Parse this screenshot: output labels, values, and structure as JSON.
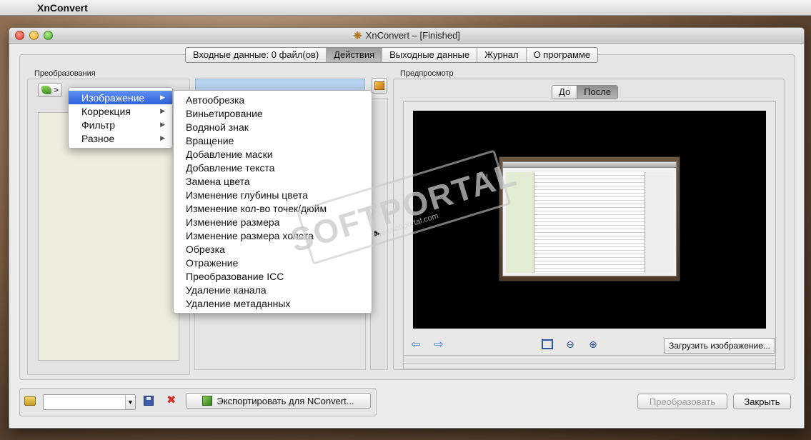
{
  "menubar": {
    "app_name": "XnConvert"
  },
  "window": {
    "title": "XnConvert – [Finished]"
  },
  "tabs": [
    {
      "label": "Входные данные: 0 файл(ов)"
    },
    {
      "label": "Действия"
    },
    {
      "label": "Выходные данные"
    },
    {
      "label": "Журнал"
    },
    {
      "label": "О программе"
    }
  ],
  "active_tab": "Действия",
  "left": {
    "group_label": "Преобразования",
    "toolbar_arrow": ">"
  },
  "preview": {
    "group_label": "Предпросмотр",
    "before_label": "До",
    "after_label": "После",
    "load_button": "Загрузить изображение..."
  },
  "menu_categories": [
    {
      "label": "Изображение"
    },
    {
      "label": "Коррекция"
    },
    {
      "label": "Фильтр"
    },
    {
      "label": "Разное"
    }
  ],
  "menu_image_actions": [
    "Автообрезка",
    "Виньетирование",
    "Водяной знак",
    "Вращение",
    "Добавление маски",
    "Добавление текста",
    "Замена цвета",
    "Изменение глубины цвета",
    "Изменение кол-во точек/дюйм",
    "Изменение размера",
    "Изменение размера холста",
    "Обрезка",
    "Отражение",
    "Преобразование ICC",
    "Удаление канала",
    "Удаление метаданных"
  ],
  "bottom": {
    "export_button": "Экспортировать для NConvert...",
    "convert_button": "Преобразовать",
    "close_button": "Закрыть"
  },
  "watermark": {
    "text": "SOFTPORTAL",
    "url": "www.softportal.com",
    "tm": "TM"
  },
  "colors": {
    "selection": "#3a6ee3",
    "accent_input": "#b7d1f0"
  }
}
